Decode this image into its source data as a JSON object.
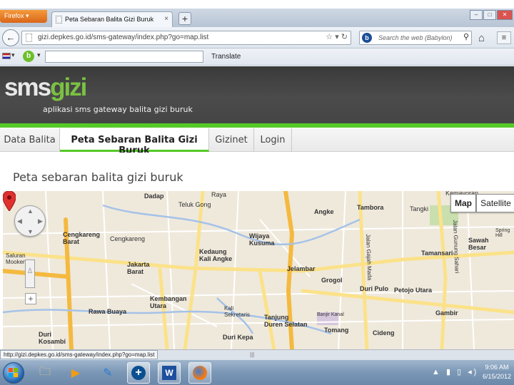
{
  "browser": {
    "menu_button": "Firefox",
    "tab_title": "Peta Sebaran Balita Gizi Buruk",
    "new_tab": "+",
    "url": "gizi.depkes.go.id/sms-gateway/index.php?go=map.list",
    "search_placeholder": "Search the web (Babylon)",
    "translate_label": "Translate"
  },
  "site": {
    "logo_sms": "sms",
    "logo_gizi": "gizi",
    "tagline": "aplikasi sms gateway balita gizi buruk"
  },
  "nav": {
    "items": [
      {
        "label": "Data Balita"
      },
      {
        "label": "Peta Sebaran Balita Gizi Buruk"
      },
      {
        "label": "Gizinet"
      },
      {
        "label": "Login"
      }
    ]
  },
  "page": {
    "title": "Peta sebaran balita gizi buruk"
  },
  "map": {
    "type_buttons": {
      "map": "Map",
      "satellite": "Satellite"
    },
    "labels": {
      "raya": "Raya",
      "dadap": "Dadap",
      "teluk_gong": "Teluk Gong",
      "angke": "Angke",
      "tambora": "Tambora",
      "tangki": "Tangki",
      "cengkareng_barat": "Cengkareng\nBarat",
      "cengkareng": "Cengkareng",
      "wijaya_kusuma": "Wijaya\nKusuma",
      "kedaung_kali_angke": "Kedaung\nKali Angke",
      "jakarta_barat": "Jakarta\nBarat",
      "jelambar": "Jelambar",
      "tamansari": "Tamansari",
      "sawah_besar": "Sawah\nBesar",
      "saluran_mookervart": "Saluran\nMookervart",
      "grogol": "Grogol",
      "duri_pulo": "Duri Pulo",
      "petojo_utara": "Petojo Utara",
      "kembangan_utara": "Kembangan\nUtara",
      "rawa_buaya": "Rawa Buaya",
      "kali_sekretaris": "Kali\nSekretaris",
      "tanjung_duren_selatan": "Tanjung\nDuren Selatan",
      "banjir_kanal": "Banjir Kanal",
      "gambir": "Gambir",
      "duri_kosambi": "Duri\nKosambi",
      "duri_kepa": "Duri Kepa",
      "tomang": "Tomang",
      "cideng": "Cideng",
      "jalan_gajah_mada": "Jalan Gajah Mada",
      "jalan_gunung_sahari": "Jalan Gunung Sahari",
      "springhill": "Spring\nHill",
      "kemayoran": "Kemayoran"
    }
  },
  "status": {
    "url": "http://gizi.depkes.go.id/sms-gateway/index.php?go=map.list"
  },
  "taskbar": {
    "time": "9:06 AM",
    "date": "6/15/2012"
  }
}
